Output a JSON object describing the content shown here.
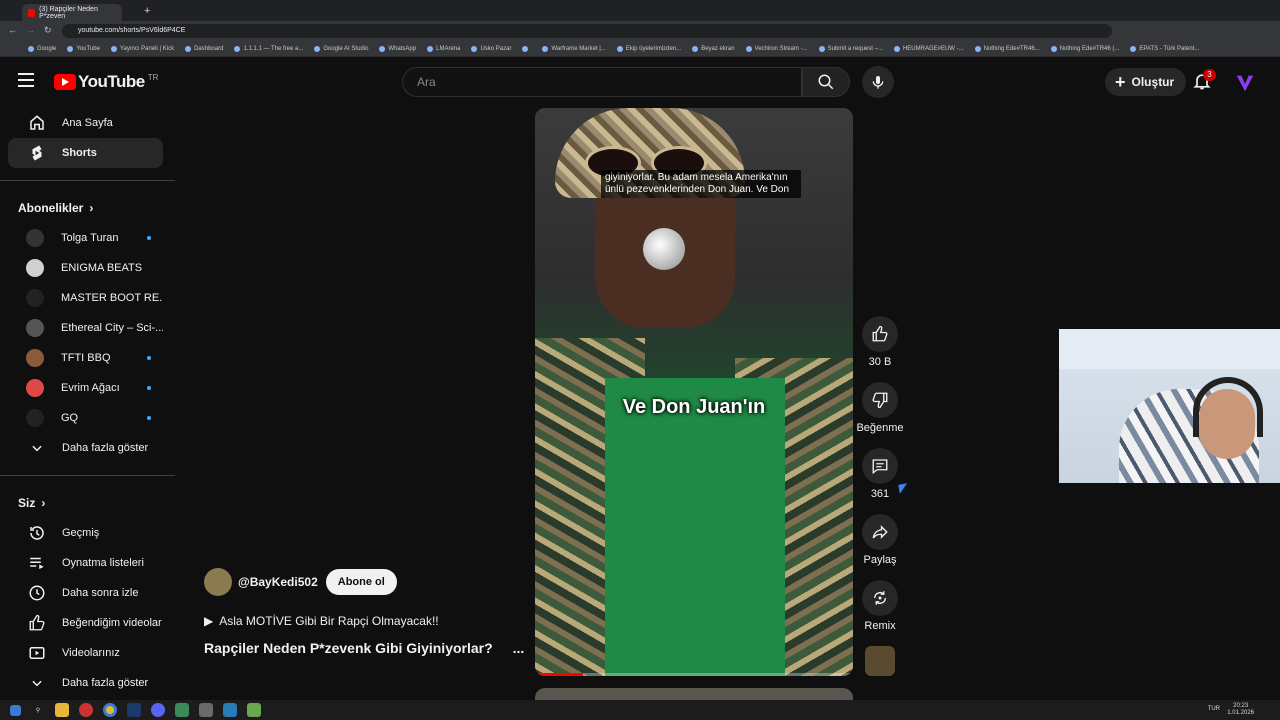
{
  "browser": {
    "tab_title": "(3) Rapçiler Neden P*zeven",
    "url": "youtube.com/shorts/PsV6ld6P4CE",
    "bookmarks": [
      "Google",
      "YouTube",
      "Yayıncı Paneli | Kick",
      "Dashboard",
      "1.1.1.1 — The free a...",
      "Google AI Studio",
      "WhatsApp",
      "LMArena",
      "Uskо Pazar",
      "",
      "Warframe Market |...",
      "Ekip üyelerimizden...",
      "Beyaz ekran",
      "Vechiron Stream -...",
      "Submit a request –...",
      "HEUMRAGE#EUW -...",
      "Nothing Ede#TR46...",
      "Nothing Ede#TR46 (...",
      "EPATS - Türk Patent..."
    ]
  },
  "header": {
    "logo_text": "YouTube",
    "region": "TR",
    "search_placeholder": "Ara",
    "create_label": "Oluştur",
    "notif_count": "3"
  },
  "sidebar": {
    "main": [
      {
        "label": "Ana Sayfa",
        "icon": "home-icon"
      },
      {
        "label": "Shorts",
        "icon": "shorts-icon"
      }
    ],
    "subs_title": "Abonelikler",
    "subs": [
      {
        "label": "Tolga Turan",
        "color": "#333333",
        "new": true
      },
      {
        "label": "ENIGMA BEATS",
        "color": "#d0d0d0",
        "new": false
      },
      {
        "label": "MASTER BOOT RE...",
        "color": "#222222",
        "new": false
      },
      {
        "label": "Ethereal City – Sci-...",
        "color": "#555555",
        "new": false
      },
      {
        "label": "TFTI BBQ",
        "color": "#8a5a3a",
        "new": true
      },
      {
        "label": "Evrim Ağacı",
        "color": "#e04848",
        "new": true
      },
      {
        "label": "GQ",
        "color": "#222222",
        "new": true
      }
    ],
    "subs_more": "Daha fazla göster",
    "you_title": "Siz",
    "you": [
      {
        "label": "Geçmiş",
        "icon": "history-icon"
      },
      {
        "label": "Oynatma listeleri",
        "icon": "playlists-icon"
      },
      {
        "label": "Daha sonra izle",
        "icon": "watch-later-icon"
      },
      {
        "label": "Beğendiğim videolar",
        "icon": "liked-icon"
      },
      {
        "label": "Videolarınız",
        "icon": "your-videos-icon"
      },
      {
        "label": "Daha fazla göster",
        "icon": "chevron-down-icon"
      }
    ]
  },
  "short": {
    "caption_top": "giyiniyorlar. Bu adam mesela Amerika'nın ünlü pezevenklerinden Don Juan. Ve Don",
    "caption_big": "Ve Don Juan'ın",
    "progress": 0.15,
    "channel": "@BayKedi502",
    "subscribe_label": "Abone ol",
    "music": "Asla MOTİVE Gibi Bir Rapçi Olmayacak!!",
    "title": "Rapçiler Neden P*zevenk Gibi Giyiniyorlar?",
    "more": "..."
  },
  "actions": {
    "like_count": "30 B",
    "dislike_label": "Beğenme",
    "comment_count": "361",
    "share_label": "Paylaş",
    "remix_label": "Remix"
  },
  "taskbar": {
    "lang": "TUR",
    "time": "20:23",
    "date": "1.01.2026"
  }
}
